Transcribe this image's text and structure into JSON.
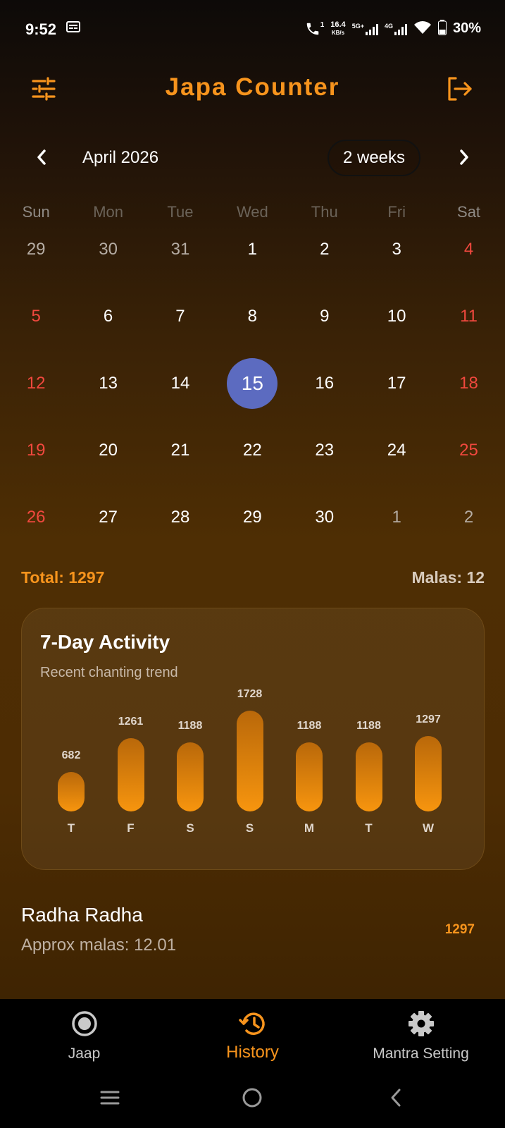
{
  "status_bar": {
    "time": "9:52",
    "speed_value": "16.4",
    "speed_unit": "KB/s",
    "net1": "5G+",
    "net2": "4G",
    "call_badge": "1",
    "battery": "30%"
  },
  "app": {
    "title": "Japa Counter",
    "filter_icon": "tune-icon",
    "logout_icon": "logout-icon",
    "accent": "#f7941d"
  },
  "calendar": {
    "month_label": "April 2026",
    "range_button": "2 weeks",
    "weekdays": [
      "Sun",
      "Mon",
      "Tue",
      "Wed",
      "Thu",
      "Fri",
      "Sat"
    ],
    "weeks": [
      [
        "29",
        "30",
        "31",
        "1",
        "2",
        "3",
        "4"
      ],
      [
        "5",
        "6",
        "7",
        "8",
        "9",
        "10",
        "11"
      ],
      [
        "12",
        "13",
        "14",
        "15",
        "16",
        "17",
        "18"
      ],
      [
        "19",
        "20",
        "21",
        "22",
        "23",
        "24",
        "25"
      ],
      [
        "26",
        "27",
        "28",
        "29",
        "30",
        "1",
        "2"
      ]
    ],
    "selected_day": "15",
    "selected_color": "#5c6bc0",
    "weekend_color": "#f0483e"
  },
  "summary": {
    "total": "Total: 1297",
    "malas": "Malas: 12"
  },
  "activity": {
    "title": "7-Day Activity",
    "subtitle": "Recent chanting trend"
  },
  "chart_data": {
    "type": "bar",
    "categories": [
      "T",
      "F",
      "S",
      "S",
      "M",
      "T",
      "W"
    ],
    "values": [
      682,
      1261,
      1188,
      1728,
      1188,
      1188,
      1297
    ],
    "title": "7-Day Activity",
    "subtitle": "Recent chanting trend",
    "xlabel": "",
    "ylabel": "",
    "grid": false
  },
  "entry": {
    "name": "Radha Radha",
    "approx": "Approx malas: 12.01",
    "count": "1297"
  },
  "bottom_nav": {
    "items": [
      {
        "label": "Jaap",
        "icon": "radio-button-icon"
      },
      {
        "label": "History",
        "icon": "history-icon",
        "active": true
      },
      {
        "label": "Mantra Setting",
        "icon": "gear-icon"
      }
    ]
  },
  "system_nav": {
    "icons": [
      "menu-icon",
      "home-circle-icon",
      "back-icon"
    ]
  }
}
